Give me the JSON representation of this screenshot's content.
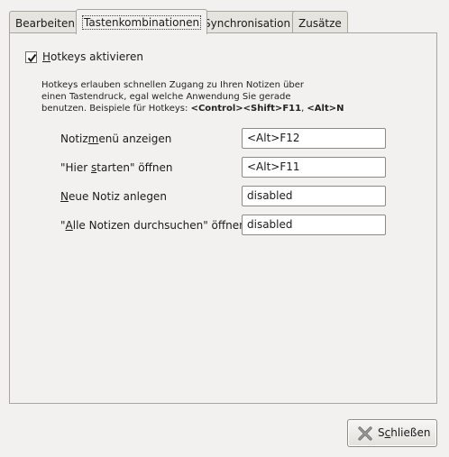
{
  "tabs": [
    {
      "label": "Bearbeiten"
    },
    {
      "label": "Tastenkombinationen",
      "active": true
    },
    {
      "label": "Synchronisation"
    },
    {
      "label": "Zusätze"
    }
  ],
  "hotkeys": {
    "enable_label": "Hotkeys aktivieren",
    "enable_label_mnemonic": "H",
    "enable_label_rest": "otkeys aktivieren",
    "checked": true,
    "description_line1": "Hotkeys erlauben schnellen Zugang zu Ihren Notizen über",
    "description_line2": "einen Tastendruck, egal welche Anwendung Sie gerade",
    "description_line3_prefix": "benutzen. Beispiele für Hotkeys: ",
    "description_line3_bold1": "<Control>",
    "description_line3_bold2": "<Shift>",
    "description_line3_bold3": "F11",
    "description_line3_sep": ", ",
    "description_line3_bold4": "<Alt>",
    "description_line3_bold5": "N"
  },
  "shortcuts": [
    {
      "label_pre": "Notiz",
      "label_mn": "m",
      "label_post": "enü anzeigen",
      "value": "<Alt>F12"
    },
    {
      "label_pre": "\"Hier ",
      "label_mn": "s",
      "label_post": "tarten\" öffnen",
      "value": "<Alt>F11"
    },
    {
      "label_pre": "",
      "label_mn": "N",
      "label_post": "eue Notiz anlegen",
      "value": "disabled"
    },
    {
      "label_pre": "\"",
      "label_mn": "A",
      "label_post": "lle Notizen durchsuchen\" öffnen",
      "value": "disabled"
    }
  ],
  "close_button": {
    "label_pre": "S",
    "label_mn": "c",
    "label_post": "hließen",
    "icon": "close-x-icon"
  }
}
